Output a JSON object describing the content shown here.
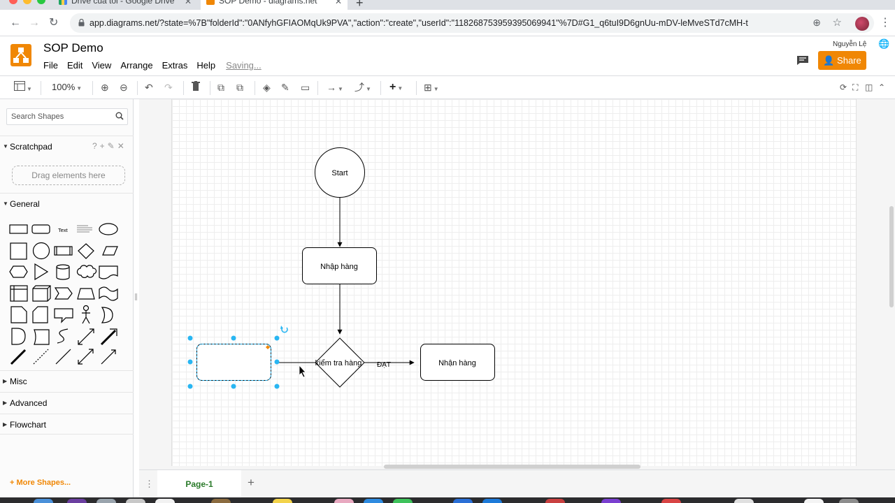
{
  "browser": {
    "tabs": [
      {
        "title": "Drive của tôi - Google Drive",
        "active": false
      },
      {
        "title": "SOP Demo - diagrams.net",
        "active": true
      }
    ],
    "url": "app.diagrams.net/?state=%7B\"folderId\":\"0ANfyhGFIAOMqUk9PVA\",\"action\":\"create\",\"userId\":\"118268753959395069941\"%7D#G1_q6tuI9D6gnUu-mDV-leMveSTd7cMH-t"
  },
  "app": {
    "title": "SOP Demo",
    "menu": [
      "File",
      "Edit",
      "View",
      "Arrange",
      "Extras",
      "Help"
    ],
    "status": "Saving...",
    "user": "Nguyễn Lệ",
    "share_label": "Share",
    "zoom": "100%"
  },
  "sidebar": {
    "search_placeholder": "Search Shapes",
    "scratchpad": {
      "label": "Scratchpad",
      "drop_hint": "Drag elements here",
      "tools": "?+✎✕"
    },
    "general_label": "General",
    "text_shape_label": "Text",
    "sections": [
      "Misc",
      "Advanced",
      "Flowchart"
    ],
    "more_shapes": "+ More Shapes..."
  },
  "diagram": {
    "nodes": {
      "start": "Start",
      "nhap": "Nhập hàng",
      "kiem": "kiểm tra hàng",
      "nhan": "Nhận hàng",
      "selected": ""
    },
    "edge_label": "ĐẠT"
  },
  "pages": {
    "current": "Page-1"
  },
  "colors": {
    "accent": "#f08705",
    "selection": "#29b6f2",
    "page_tab": "#2a7a2a"
  }
}
